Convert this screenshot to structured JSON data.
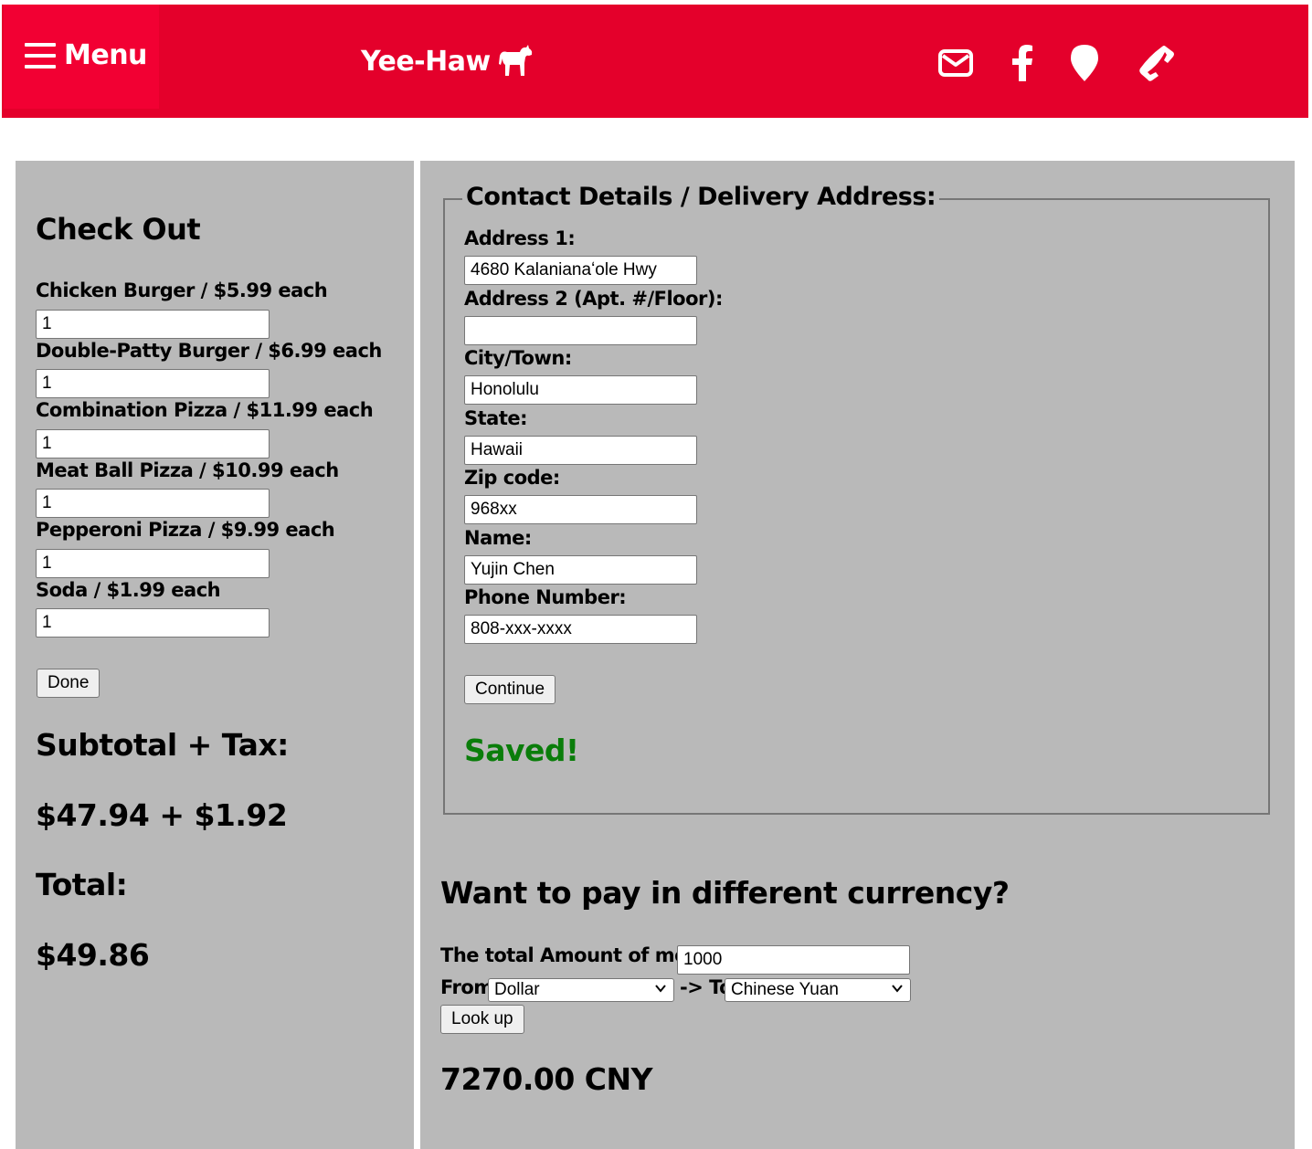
{
  "header": {
    "menu_label": "Menu",
    "brand": "Yee-Haw",
    "icons": [
      "envelope-icon",
      "facebook-icon",
      "map-marker-icon",
      "phone-icon"
    ],
    "colors": {
      "bar": "#e4002b",
      "menu_button": "#f20033"
    }
  },
  "checkout": {
    "title": "Check Out",
    "items": [
      {
        "label": "Chicken Burger / $5.99 each",
        "qty": "1"
      },
      {
        "label": "Double-Patty Burger / $6.99 each",
        "qty": "1"
      },
      {
        "label": "Combination Pizza / $11.99 each",
        "qty": "1"
      },
      {
        "label": "Meat Ball Pizza / $10.99 each",
        "qty": "1"
      },
      {
        "label": "Pepperoni Pizza / $9.99 each",
        "qty": "1"
      },
      {
        "label": "Soda / $1.99 each",
        "qty": "1"
      }
    ],
    "done_label": "Done",
    "subtotal_heading": "Subtotal + Tax:",
    "subtotal_value": "$47.94 + $1.92",
    "total_heading": "Total:",
    "total_value": "$49.86"
  },
  "contact": {
    "legend": "Contact Details / Delivery Address:",
    "fields": [
      {
        "label": "Address 1:",
        "value": "4680 Kalanianaʻole Hwy"
      },
      {
        "label": "Address 2 (Apt. #/Floor):",
        "value": ""
      },
      {
        "label": "City/Town:",
        "value": "Honolulu"
      },
      {
        "label": "State:",
        "value": "Hawaii"
      },
      {
        "label": "Zip code:",
        "value": "968xx"
      },
      {
        "label": "Name:",
        "value": "Yujin Chen"
      },
      {
        "label": "Phone Number:",
        "value": "808-xxx-xxxx"
      }
    ],
    "continue_label": "Continue",
    "saved_text": "Saved!",
    "saved_color": "#0a7d0a"
  },
  "currency": {
    "title": "Want to pay in different currency?",
    "amount_label": "The total Amount of money",
    "amount_value": "1000",
    "from_label": "From",
    "from_value": "Dollar",
    "to_label": "-> To",
    "to_value": "Chinese Yuan",
    "lookup_label": "Look up",
    "result": "7270.00 CNY"
  },
  "colors": {
    "panel": "#b9b9b9"
  }
}
